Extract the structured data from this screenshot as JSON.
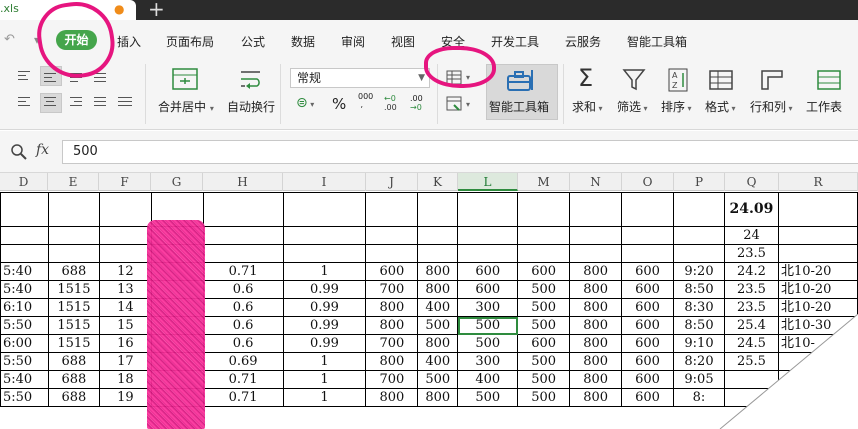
{
  "titlebar": {
    "filename": ".xls",
    "new_tab_symbol": "+"
  },
  "menu": {
    "undo_symbol": "↶",
    "items": [
      "开始",
      "插入",
      "页面布局",
      "公式",
      "数据",
      "审阅",
      "视图",
      "安全",
      "开发工具",
      "云服务",
      "智能工具箱"
    ]
  },
  "ribbon": {
    "merge_center": "合并居中",
    "wrap_text": "自动换行",
    "number_format": "常规",
    "percent": "%",
    "thousands": "000",
    "inc_decimal_top": "←0",
    "inc_decimal_bot": ".00",
    "dec_decimal_top": ".00",
    "dec_decimal_bot": "→0",
    "smart_toolbox": "智能工具箱",
    "sum": "求和",
    "filter": "筛选",
    "sort": "排序",
    "format": "格式",
    "rowcol": "行和列",
    "worksheet": "工作表"
  },
  "formula_bar": {
    "fx": "fx",
    "content": "500"
  },
  "columns": [
    "D",
    "E",
    "F",
    "G",
    "H",
    "I",
    "J",
    "K",
    "L",
    "M",
    "N",
    "O",
    "P",
    "Q",
    "R"
  ],
  "selected_column": "L",
  "rows": [
    [
      "",
      "",
      "",
      "",
      "",
      "",
      "",
      "",
      "",
      "",
      "",
      "",
      "",
      "24.09",
      ""
    ],
    [
      "",
      "",
      "",
      "",
      "",
      "",
      "",
      "",
      "",
      "",
      "",
      "",
      "",
      "24",
      ""
    ],
    [
      "",
      "",
      "",
      "",
      "",
      "",
      "",
      "",
      "",
      "",
      "",
      "",
      "",
      "23.5",
      ""
    ],
    [
      "5:40",
      "688",
      "12",
      "",
      "0.71",
      "1",
      "600",
      "800",
      "600",
      "600",
      "800",
      "600",
      "9:20",
      "24.2",
      "北10-20"
    ],
    [
      "5:40",
      "1515",
      "13",
      "",
      "0.6",
      "0.99",
      "700",
      "800",
      "600",
      "500",
      "800",
      "600",
      "8:50",
      "23.5",
      "北10-20"
    ],
    [
      "6:10",
      "1515",
      "14",
      "",
      "0.6",
      "0.99",
      "800",
      "400",
      "300",
      "500",
      "800",
      "600",
      "8:30",
      "23.5",
      "北10-20"
    ],
    [
      "5:50",
      "1515",
      "15",
      "",
      "0.6",
      "0.99",
      "800",
      "500",
      "500",
      "500",
      "800",
      "600",
      "8:50",
      "25.4",
      "北10-30"
    ],
    [
      "6:00",
      "1515",
      "16",
      "",
      "0.6",
      "0.99",
      "700",
      "800",
      "500",
      "600",
      "800",
      "600",
      "9:10",
      "24.5",
      "北10-"
    ],
    [
      "5:50",
      "688",
      "17",
      "",
      "0.69",
      "1",
      "800",
      "400",
      "300",
      "500",
      "800",
      "600",
      "8:20",
      "25.5",
      ""
    ],
    [
      "5:40",
      "688",
      "18",
      "",
      "0.71",
      "1",
      "700",
      "500",
      "400",
      "500",
      "800",
      "600",
      "9:05",
      "",
      ""
    ],
    [
      "5:50",
      "688",
      "19",
      "",
      "0.71",
      "1",
      "800",
      "800",
      "500",
      "500",
      "800",
      "600",
      "8:",
      "",
      ""
    ]
  ]
}
